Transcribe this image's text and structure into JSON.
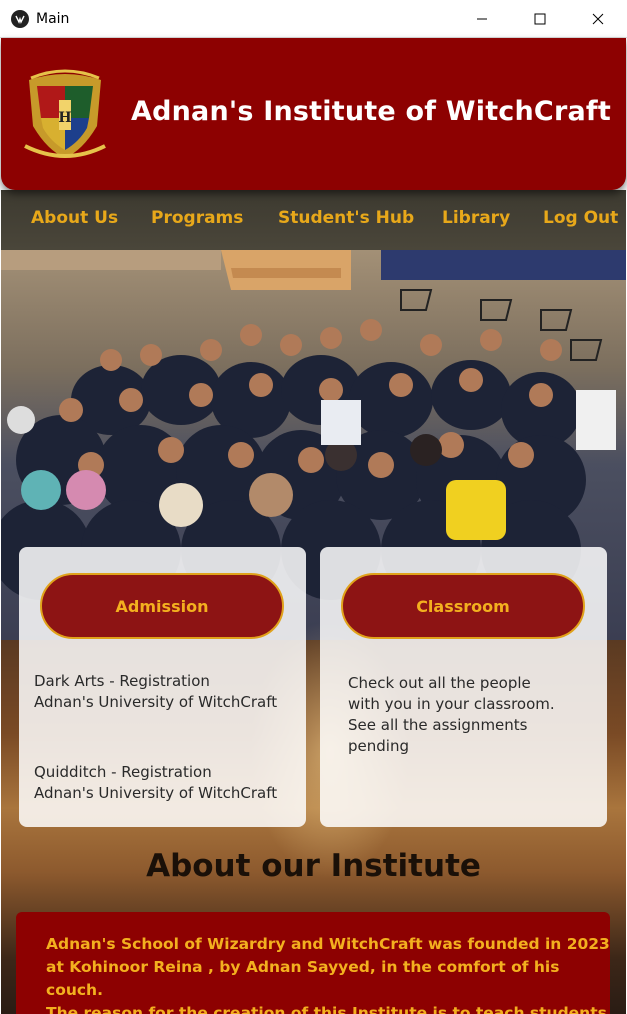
{
  "window": {
    "title": "Main"
  },
  "header": {
    "title": "Adnan's Institute of WitchCraft"
  },
  "nav": {
    "items": [
      {
        "label": "About Us"
      },
      {
        "label": "Programs"
      },
      {
        "label": "Student's Hub"
      },
      {
        "label": "Library"
      },
      {
        "label": "Log Out"
      }
    ]
  },
  "cards": {
    "admission": {
      "button_label": "Admission",
      "item1_line1": "Dark Arts - Registration",
      "item1_line2": "Adnan's University of WitchCraft",
      "item2_line1": "Quidditch - Registration",
      "item2_line2": "Adnan's University of WitchCraft"
    },
    "classroom": {
      "button_label": "Classroom",
      "line1": "Check out all the people",
      "line2": "with you in your classroom.",
      "line3": "See all the assignments",
      "line4": "pending"
    }
  },
  "about": {
    "title": "About our Institute",
    "line1": "Adnan's School of Wizardry and WitchCraft was founded in 2023",
    "line2": "at Kohinoor Reina , by Adnan Sayyed, in the comfort of his",
    "line3": "couch.",
    "line4": "The reason for the creation of this Institute is to teach students"
  },
  "colors": {
    "header_bg": "#8d0101",
    "nav_text": "#e8a81a",
    "button_bg": "#8d1414",
    "button_text": "#f3b01f"
  }
}
